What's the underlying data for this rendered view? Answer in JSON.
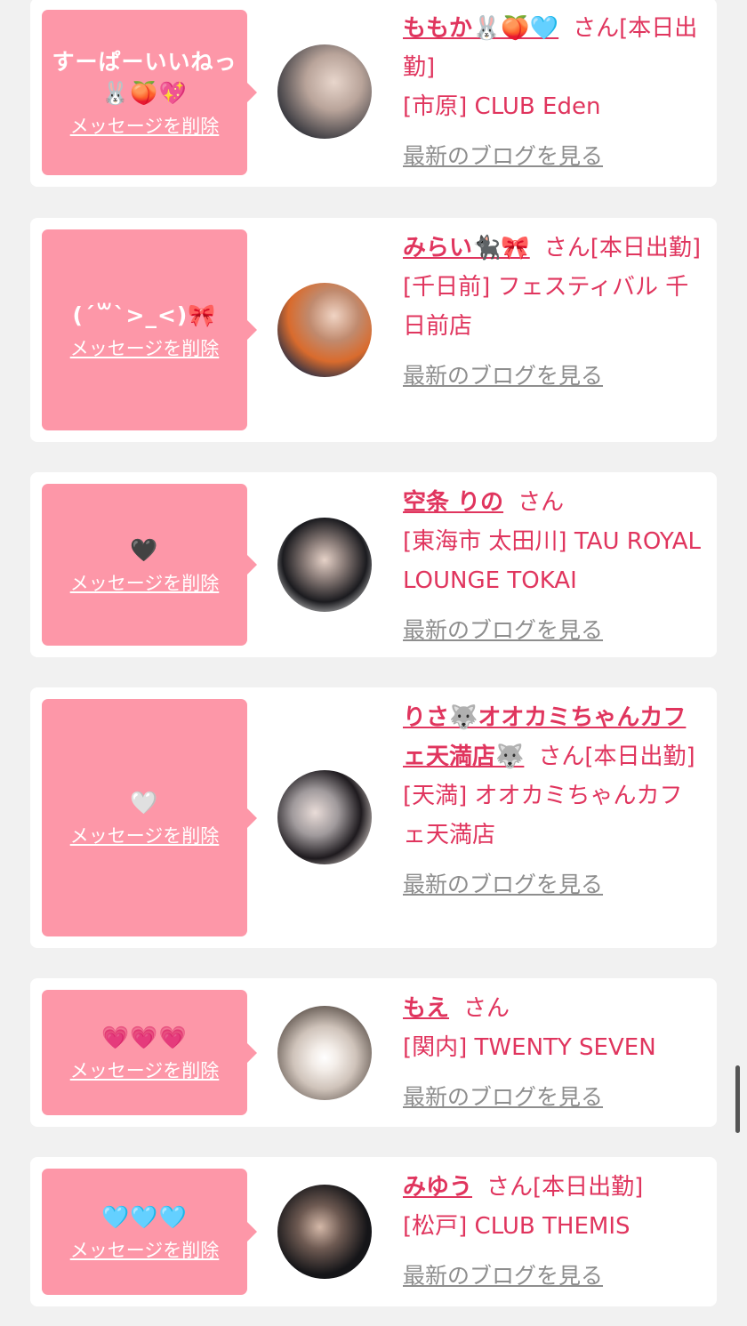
{
  "delete_label": "メッセージを削除",
  "blog_label": "最新のブログを見る",
  "san": "さん",
  "colors": {
    "background": "#f1f1f1",
    "bubble": "#fd97a8",
    "accent": "#e0355e",
    "link_gray": "#8e8e8e"
  },
  "messages": [
    {
      "message": "すーぱーいいねっ🐰🍑💖",
      "name": "ももか🐰🍑🩵",
      "status": "[本日出勤]",
      "shop": "[市原] CLUB Eden"
    },
    {
      "message": "(ˊ꒳ˋ>_<)🎀",
      "name": "みらい🐈‍⬛🎀",
      "status": "[本日出勤]",
      "shop": "[千日前] フェスティバル 千日前店"
    },
    {
      "message": "🖤",
      "name": "空条 りの",
      "status": "",
      "shop": "[東海市 太田川] TAU ROYAL LOUNGE TOKAI"
    },
    {
      "message": "🤍",
      "name": "りさ🐺オオカミちゃんカフェ天満店🐺",
      "status": "[本日出勤]",
      "shop": "[天満] オオカミちゃんカフェ天満店"
    },
    {
      "message": "💗💗💗",
      "name": "もえ",
      "status": "",
      "shop": "[関内] TWENTY SEVEN"
    },
    {
      "message": "🩵🩵🩵",
      "name": "みゆう",
      "status": "[本日出勤]",
      "shop": "[松戸] CLUB THEMIS"
    }
  ]
}
